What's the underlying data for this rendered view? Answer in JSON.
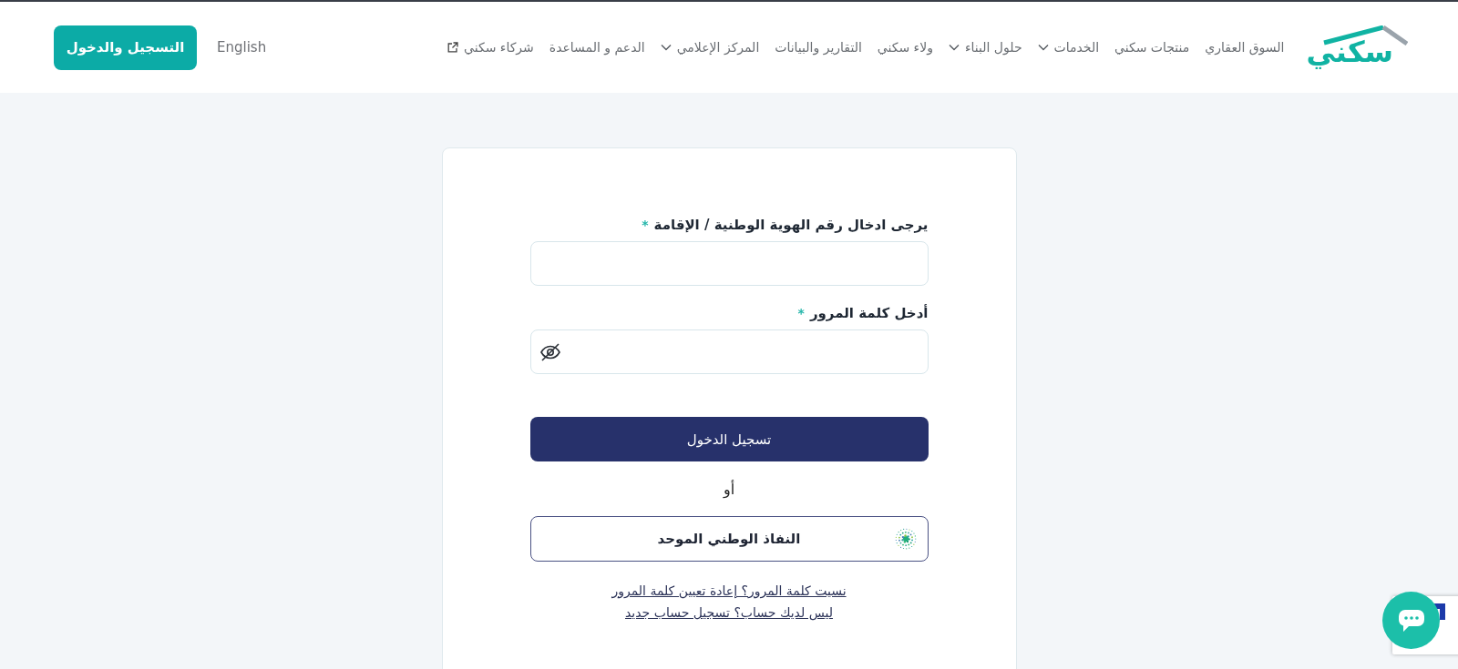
{
  "header": {
    "logo": "سكني",
    "nav": [
      {
        "label": "السوق العقاري",
        "kind": "link"
      },
      {
        "label": "منتجات سكني",
        "kind": "link"
      },
      {
        "label": "الخدمات",
        "kind": "dropdown"
      },
      {
        "label": "حلول البناء",
        "kind": "dropdown"
      },
      {
        "label": "ولاء سكني",
        "kind": "link"
      },
      {
        "label": "التقارير والبيانات",
        "kind": "link"
      },
      {
        "label": "المركز الإعلامي",
        "kind": "dropdown"
      },
      {
        "label": "الدعم و المساعدة",
        "kind": "link"
      },
      {
        "label": "شركاء سكني",
        "kind": "external"
      }
    ],
    "language": "English",
    "register_button": "التسجيل والدخول"
  },
  "login_form": {
    "fields": [
      {
        "label": "يرجى ادخال رقم الهوية الوطنية / الإقامة",
        "required_mark": "*",
        "kind": "text"
      },
      {
        "label": "أدخل كلمة المرور",
        "required_mark": "*",
        "kind": "password"
      }
    ],
    "submit_button": "تسجيل الدخول",
    "separator": "أو",
    "nafath_button": "النفاذ الوطني الموحد",
    "forgot_password_link": "نسيت كلمة المرور؟ إعادة تعيين كلمة المرور",
    "register_link": "ليس لديك حساب؟ تسجيل حساب جديد"
  }
}
